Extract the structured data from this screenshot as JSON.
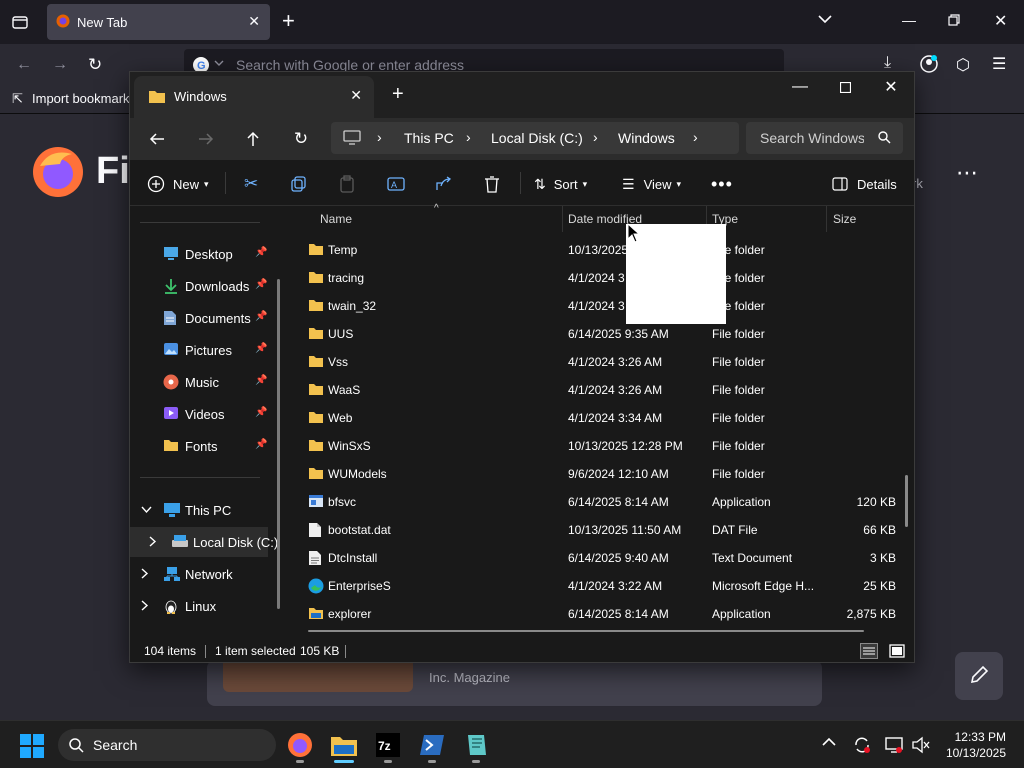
{
  "firefox": {
    "tab_title": "New Tab",
    "url_placeholder": "Search with Google or enter address",
    "bookmark_item": "Import bookmarks",
    "brand_text": "Fi",
    "card_caption": "Inc. Magazine",
    "side_text": "rk"
  },
  "explorer": {
    "tab_title": "Windows",
    "breadcrumb": [
      "This PC",
      "Local Disk (C:)",
      "Windows"
    ],
    "search_placeholder": "Search Windows",
    "commands": {
      "new": "New",
      "sort": "Sort",
      "view": "View",
      "details": "Details"
    },
    "nav_quick": [
      {
        "label": "Desktop",
        "icon": "desktop-icon",
        "color": "#4aa8e8"
      },
      {
        "label": "Downloads",
        "icon": "download-icon",
        "color": "#3ec46d"
      },
      {
        "label": "Documents",
        "icon": "document-icon",
        "color": "#7fa6d6"
      },
      {
        "label": "Pictures",
        "icon": "pictures-icon",
        "color": "#4a90e2"
      },
      {
        "label": "Music",
        "icon": "music-icon",
        "color": "#e8674a"
      },
      {
        "label": "Videos",
        "icon": "videos-icon",
        "color": "#8b5cf6"
      },
      {
        "label": "Fonts",
        "icon": "folder-icon",
        "color": "#f2c14e"
      }
    ],
    "nav_tree": [
      {
        "label": "This PC",
        "icon": "pc-icon",
        "expander": "v"
      },
      {
        "label": "Local Disk (C:)",
        "icon": "drive-icon",
        "expander": ">"
      },
      {
        "label": "Network",
        "icon": "network-icon",
        "expander": ">"
      },
      {
        "label": "Linux",
        "icon": "linux-icon",
        "expander": ">"
      }
    ],
    "columns": {
      "name": "Name",
      "date": "Date modified",
      "type": "Type",
      "size": "Size"
    },
    "files": [
      {
        "name": "Temp",
        "date": "10/13/2025",
        "type": "File folder",
        "size": "",
        "icon": "folder-icon"
      },
      {
        "name": "tracing",
        "date": "4/1/2024 3",
        "type": "File folder",
        "size": "",
        "icon": "folder-icon"
      },
      {
        "name": "twain_32",
        "date": "4/1/2024 3",
        "type": "File folder",
        "size": "",
        "icon": "folder-icon"
      },
      {
        "name": "UUS",
        "date": "6/14/2025 9:35 AM",
        "type": "File folder",
        "size": "",
        "icon": "folder-icon"
      },
      {
        "name": "Vss",
        "date": "4/1/2024 3:26 AM",
        "type": "File folder",
        "size": "",
        "icon": "folder-icon"
      },
      {
        "name": "WaaS",
        "date": "4/1/2024 3:26 AM",
        "type": "File folder",
        "size": "",
        "icon": "folder-icon"
      },
      {
        "name": "Web",
        "date": "4/1/2024 3:34 AM",
        "type": "File folder",
        "size": "",
        "icon": "folder-icon"
      },
      {
        "name": "WinSxS",
        "date": "10/13/2025 12:28 PM",
        "type": "File folder",
        "size": "",
        "icon": "folder-icon"
      },
      {
        "name": "WUModels",
        "date": "9/6/2024 12:10 AM",
        "type": "File folder",
        "size": "",
        "icon": "folder-icon"
      },
      {
        "name": "bfsvc",
        "date": "6/14/2025 8:14 AM",
        "type": "Application",
        "size": "120 KB",
        "icon": "app-icon"
      },
      {
        "name": "bootstat.dat",
        "date": "10/13/2025 11:50 AM",
        "type": "DAT File",
        "size": "66 KB",
        "icon": "file-icon"
      },
      {
        "name": "DtcInstall",
        "date": "6/14/2025 9:40 AM",
        "type": "Text Document",
        "size": "3 KB",
        "icon": "text-file-icon"
      },
      {
        "name": "EnterpriseS",
        "date": "4/1/2024 3:22 AM",
        "type": "Microsoft Edge H...",
        "size": "25 KB",
        "icon": "edge-icon"
      },
      {
        "name": "explorer",
        "date": "6/14/2025 8:14 AM",
        "type": "Application",
        "size": "2,875 KB",
        "icon": "explorer-icon"
      }
    ],
    "status": {
      "count": "104 items",
      "selected": "1 item selected",
      "size": "105 KB"
    }
  },
  "taskbar": {
    "search_label": "Search",
    "time": "12:33 PM",
    "date": "10/13/2025"
  }
}
